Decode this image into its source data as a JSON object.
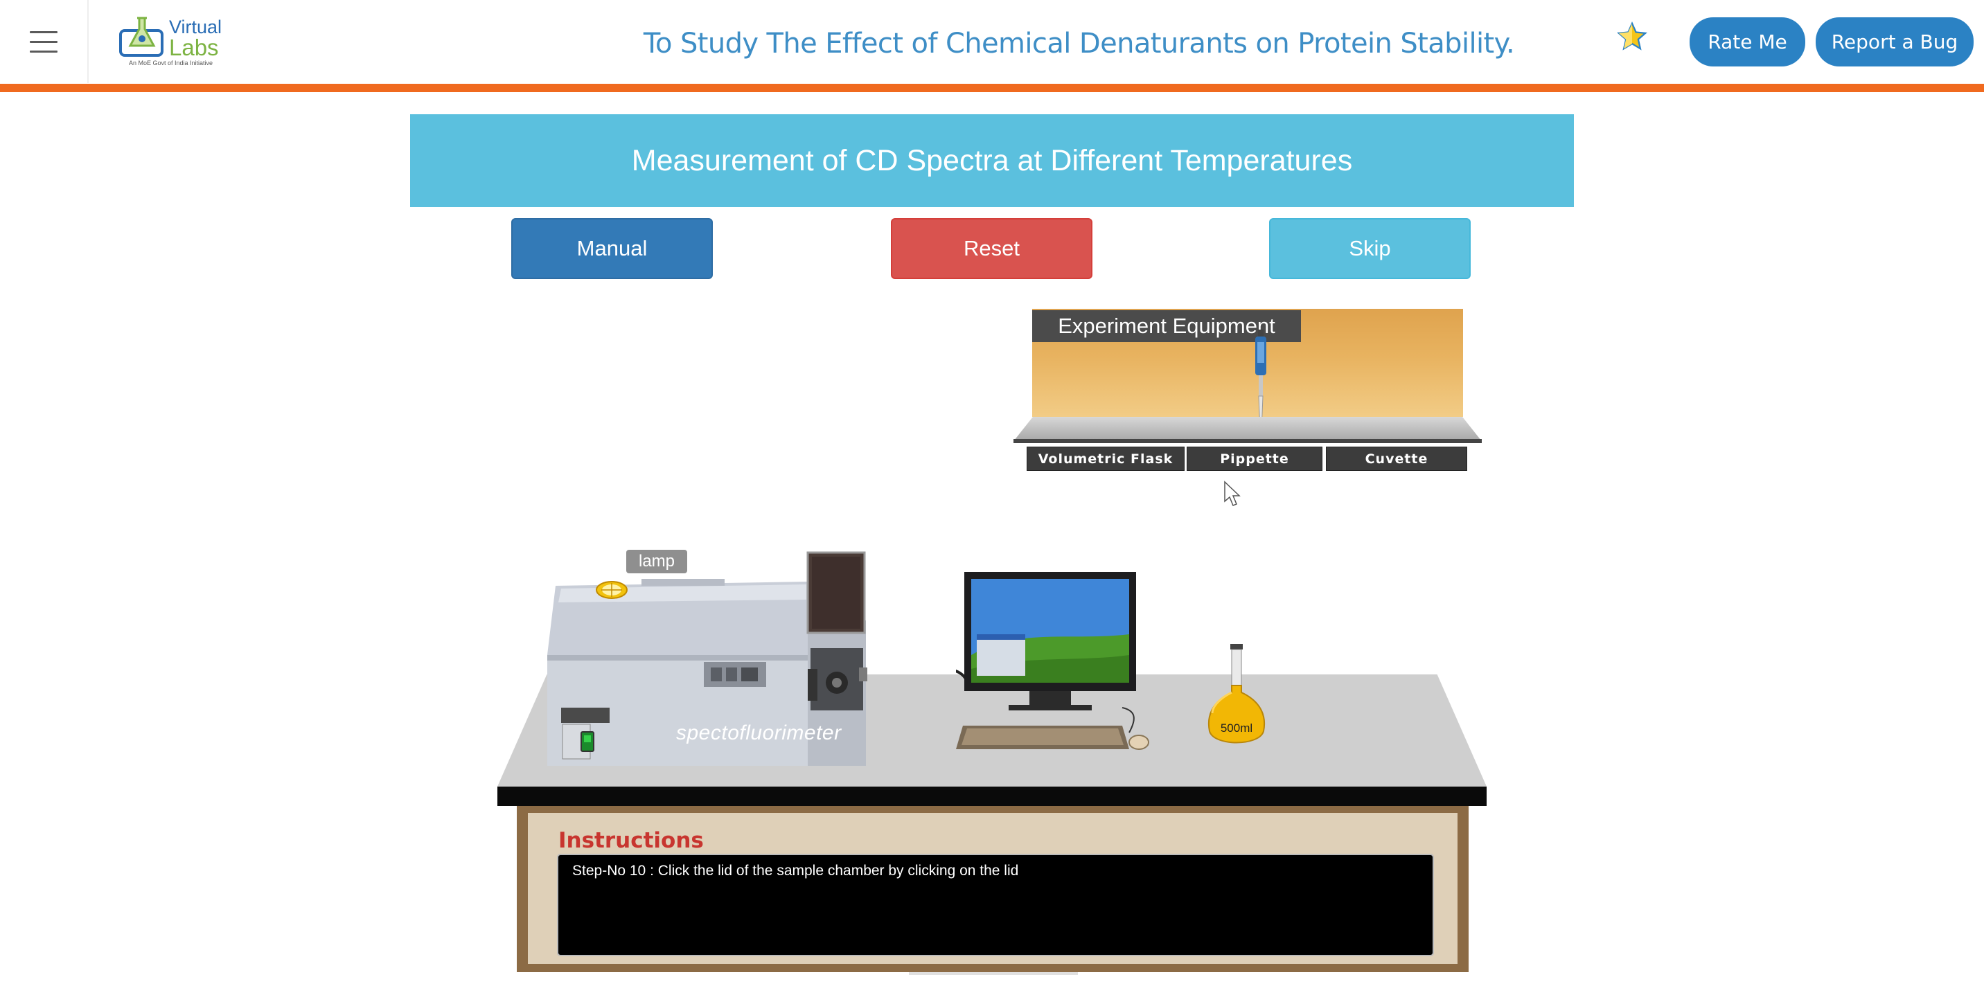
{
  "header": {
    "menu_icon": "hamburger-menu-icon",
    "logo": {
      "word1": "Virtual",
      "word2": "Labs",
      "tagline": "An MoE Govt of India Initiative"
    },
    "title": "To Study The Effect of Chemical Denaturants on Protein Stability.",
    "star_icon": "star-icon",
    "rate_label": "Rate Me",
    "bug_label": "Report a Bug"
  },
  "experiment": {
    "banner": "Measurement of CD Spectra at Different Temperatures",
    "manual_label": "Manual",
    "reset_label": "Reset",
    "skip_label": "Skip"
  },
  "equipment": {
    "title": "Experiment Equipment",
    "tabs": [
      "Volumetric Flask",
      "Pippette",
      "Cuvette"
    ]
  },
  "bench": {
    "lamp_label": "lamp",
    "device_label": "spectofluorimeter",
    "flask_label": "500ml"
  },
  "instructions": {
    "title": "Instructions",
    "text": "Step-No 10 : Click the lid of the sample chamber by clicking on the lid"
  },
  "colors": {
    "accent": "#2b82c4",
    "orange_bar": "#f06a1f",
    "banner": "#5bc0de",
    "manual": "#337ab7",
    "reset": "#d9534f",
    "skip": "#5bc0de",
    "instructions_title": "#c8352f"
  }
}
